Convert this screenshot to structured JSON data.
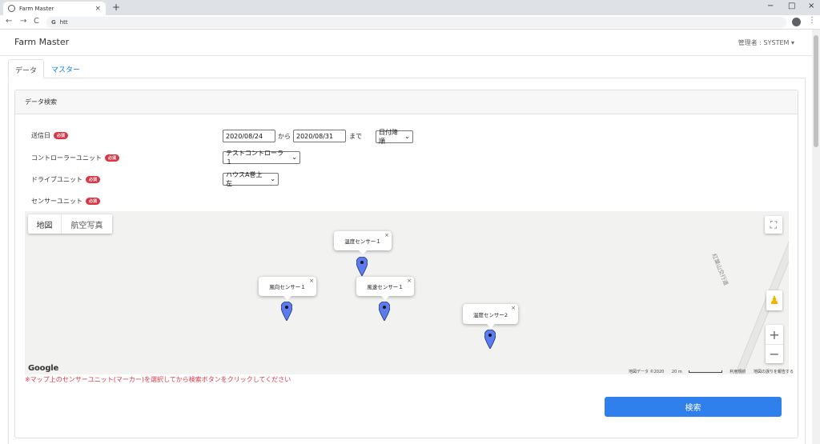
{
  "browser": {
    "tab_title": "Farm Master",
    "url": "htt",
    "close_glyph": "×",
    "newtab_glyph": "+",
    "back_glyph": "←",
    "forward_glyph": "→",
    "reload_glyph": "C",
    "g_glyph": "G",
    "minimize_glyph": "−",
    "restore_glyph": "□",
    "close_window_glyph": "×",
    "menu_glyph": "⋮"
  },
  "header": {
    "brand": "Farm Master",
    "user": "管理者 : SYSTEM ▾"
  },
  "tabs": [
    {
      "label": "データ"
    },
    {
      "label": "マスター"
    }
  ],
  "card": {
    "title": "データ検索"
  },
  "form": {
    "required_badge": "必須",
    "send_date_label": "送信日",
    "date_from": "2020/08/24",
    "from_text": "から",
    "date_to": "2020/08/31",
    "to_text": "まで",
    "sort": "日付降順",
    "controller_label": "コントローラーユニット",
    "controller_value": "テストコントローラ１",
    "drive_label": "ドライブユニット",
    "drive_value": "ハウスA巻上左",
    "sensor_label": "センサーユニット"
  },
  "map": {
    "map_button": "地図",
    "satellite_button": "航空写真",
    "fullscreen_glyph": "⛶",
    "pegman_glyph": "♟",
    "zoom_in": "+",
    "zoom_out": "−",
    "close_glyph": "×",
    "road_label": "紅葉山交行道",
    "markers": [
      {
        "label": "温度センサー１"
      },
      {
        "label": "風向センサー１"
      },
      {
        "label": "風速センサー１"
      },
      {
        "label": "温度センサー2"
      }
    ],
    "google_logo": "Google",
    "attribution": {
      "map_data": "地図データ ©2020",
      "scale": "20 m",
      "terms": "利用規約",
      "report": "地図の誤りを報告する"
    }
  },
  "note": "※マップ上のセンサーユニット(マーカー)を選択してから検索ボタンをクリックしてください",
  "search_button": "検索",
  "colors": {
    "accent": "#2f80ed",
    "danger": "#dc3545",
    "marker": "#5b7cf0"
  }
}
